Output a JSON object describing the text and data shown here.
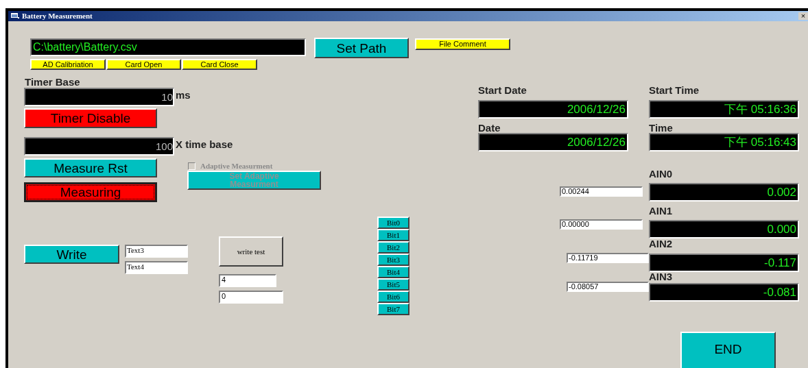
{
  "window": {
    "title": "Battery Measurement",
    "close": "×"
  },
  "path_field": {
    "value": "C:\\battery\\Battery.csv"
  },
  "set_path_button": {
    "label": "Set Path"
  },
  "file_comment_button": {
    "label": "File Comment"
  },
  "card_buttons": [
    {
      "label": "AD Calibriation"
    },
    {
      "label": "Card Open"
    },
    {
      "label": "Card Close"
    }
  ],
  "timer_base": {
    "label": "Timer Base",
    "value": "10",
    "unit": "ms"
  },
  "timer_button": {
    "label": "Timer Disable"
  },
  "multiplier": {
    "value": "100",
    "unit": "X time base"
  },
  "measure_rst_button": {
    "label": "Measure Rst"
  },
  "measuring_button": {
    "label": "Measuring",
    "focused": true
  },
  "adaptive_checkbox": {
    "label": "Adaptive Measurment",
    "checked": false,
    "disabled": true
  },
  "set_adaptive_button": {
    "label": "Set Adaptive Measurment",
    "disabled": true
  },
  "write_button": {
    "label": "Write"
  },
  "text_fields": [
    {
      "value": "Text3"
    },
    {
      "value": "Text4"
    }
  ],
  "write_test_button": {
    "label": "write test"
  },
  "number_fields": [
    {
      "value": "4"
    },
    {
      "value": "0"
    }
  ],
  "bits": [
    {
      "label": "Bit0"
    },
    {
      "label": "Bit1"
    },
    {
      "label": "Bit2"
    },
    {
      "label": "Bit3"
    },
    {
      "label": "Bit4"
    },
    {
      "label": "Bit5"
    },
    {
      "label": "Bit6"
    },
    {
      "label": "Bit7"
    }
  ],
  "start_date": {
    "label": "Start Date",
    "value": "2006/12/26"
  },
  "start_time": {
    "label": "Start Time",
    "value": "下午 05:16:36"
  },
  "date": {
    "label": "Date",
    "value": "2006/12/26"
  },
  "time": {
    "label": "Time",
    "value": "下午 05:16:43"
  },
  "channels": [
    {
      "label": "AIN0",
      "raw": "0.00244",
      "value": "0.002"
    },
    {
      "label": "AIN1",
      "raw": "0.00000",
      "value": "0.000"
    },
    {
      "label": "AIN2",
      "raw": "-0.11719",
      "value": "-0.117"
    },
    {
      "label": "AIN3",
      "raw": "-0.08057",
      "value": "-0.081"
    }
  ],
  "end_button": {
    "label": "END"
  }
}
